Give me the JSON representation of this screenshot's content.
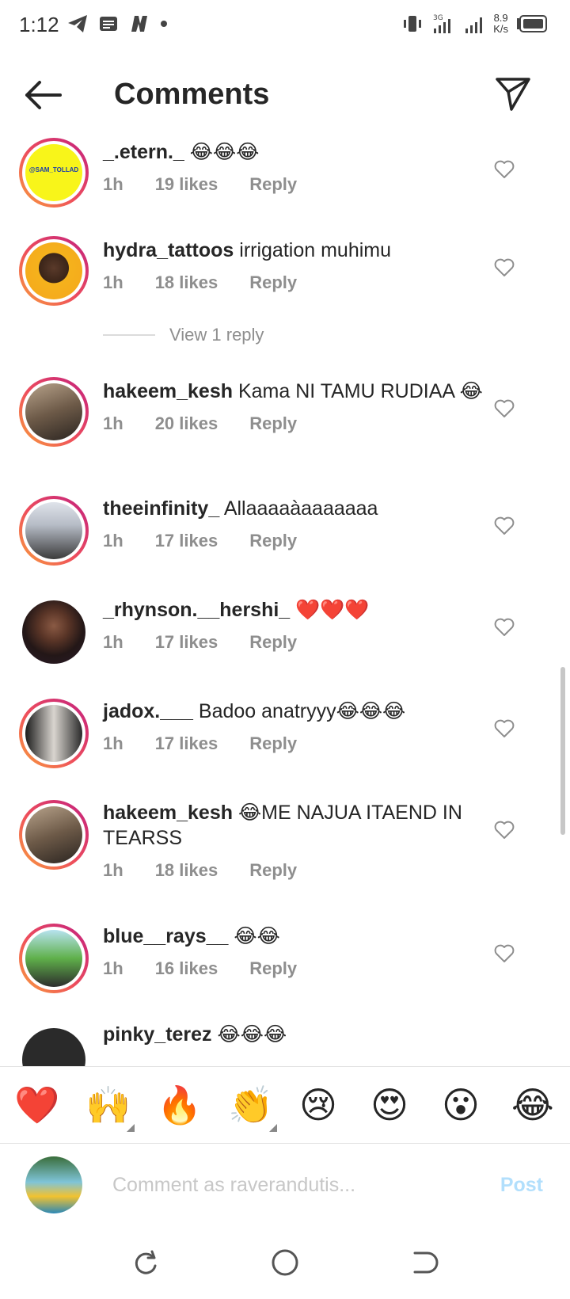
{
  "status_bar": {
    "time": "1:12",
    "speed_value": "8.9",
    "speed_unit": "K/s",
    "network": "3G"
  },
  "header": {
    "title": "Comments"
  },
  "comments": [
    {
      "username": "_.etern._",
      "text": "😂😂😂",
      "time": "1h",
      "likes": "19 likes",
      "reply": "Reply",
      "avatar_label": "@SAM_TOLLAD"
    },
    {
      "username": "hydra_tattoos",
      "text": "irrigation muhimu",
      "time": "1h",
      "likes": "18 likes",
      "reply": "Reply"
    },
    {
      "username": "hakeem_kesh",
      "text": "Kama NI TAMU RUDIAA 😂",
      "time": "1h",
      "likes": "20 likes",
      "reply": "Reply"
    },
    {
      "username": "theeinfinity_",
      "text": "Allaaaaàaaaaaaa",
      "time": "1h",
      "likes": "17 likes",
      "reply": "Reply"
    },
    {
      "username": "_rhynson.__hershi_",
      "text": "❤️❤️❤️",
      "time": "1h",
      "likes": "17 likes",
      "reply": "Reply"
    },
    {
      "username": "jadox.___",
      "text": "Badoo anatryyy😂😂😂",
      "time": "1h",
      "likes": "17 likes",
      "reply": "Reply"
    },
    {
      "username": "hakeem_kesh",
      "text": "😂ME NAJUA ITAEND IN TEARSS",
      "time": "1h",
      "likes": "18 likes",
      "reply": "Reply"
    },
    {
      "username": "blue__rays__",
      "text": "😂😂",
      "time": "1h",
      "likes": "16 likes",
      "reply": "Reply"
    },
    {
      "username": "pinky_terez",
      "text": "😂😂😂",
      "time": "",
      "likes": "",
      "reply": ""
    }
  ],
  "view_replies": "View 1 reply",
  "emoji_bar": [
    "❤️",
    "🙌",
    "🔥",
    "👏",
    "😢",
    "😍",
    "😮",
    "😂"
  ],
  "composer": {
    "placeholder": "Comment as raverandutis...",
    "post_label": "Post"
  },
  "colors": {
    "ring_start": "#f9a13c",
    "ring_end": "#c2207f",
    "post_disabled": "#b2dffc",
    "meta_gray": "#8e8e8e"
  }
}
